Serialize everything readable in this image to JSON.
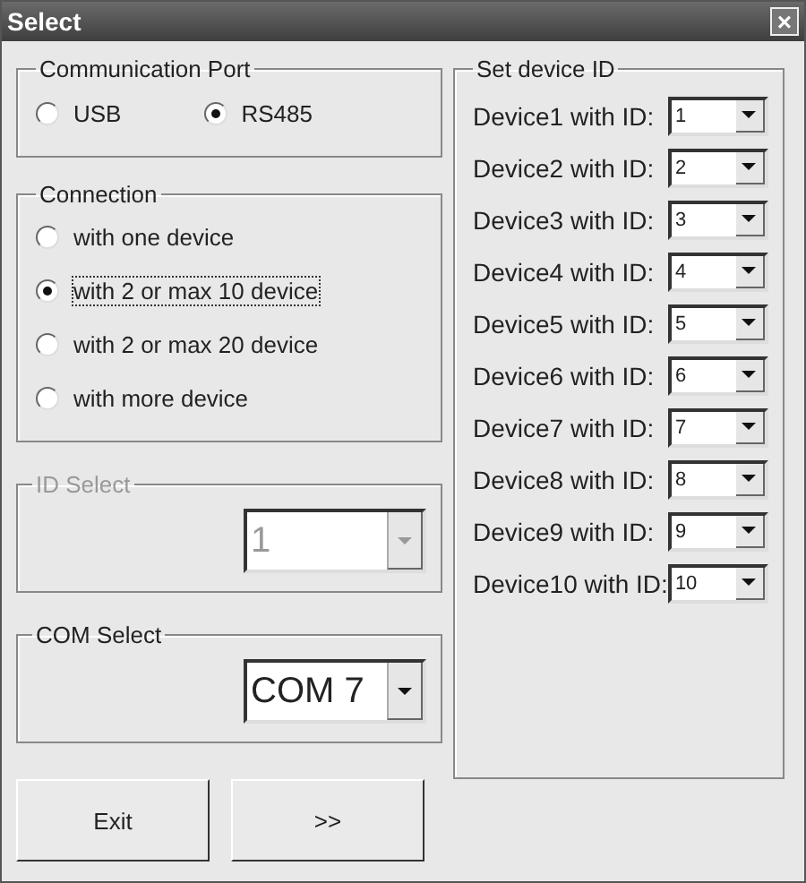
{
  "window": {
    "title": "Select",
    "close": "×"
  },
  "communication_port": {
    "title": "Communication Port",
    "options": [
      {
        "label": "USB",
        "selected": false
      },
      {
        "label": "RS485",
        "selected": true
      }
    ]
  },
  "connection": {
    "title": "Connection",
    "options": [
      {
        "label": "with one device",
        "selected": false,
        "focused": false
      },
      {
        "label": "with 2 or max 10 device",
        "selected": true,
        "focused": true
      },
      {
        "label": "with 2 or max 20 device",
        "selected": false,
        "focused": false
      },
      {
        "label": "with more device",
        "selected": false,
        "focused": false
      }
    ]
  },
  "id_select": {
    "title": "ID Select",
    "value": "1",
    "disabled": true
  },
  "com_select": {
    "title": "COM Select",
    "value": "COM 7",
    "disabled": false
  },
  "buttons": [
    "Exit",
    ">>"
  ],
  "device_ids": {
    "title": "Set device ID",
    "rows": [
      {
        "label": "Device1 with ID:",
        "value": "1"
      },
      {
        "label": "Device2 with ID:",
        "value": "2"
      },
      {
        "label": "Device3 with ID:",
        "value": "3"
      },
      {
        "label": "Device4 with ID:",
        "value": "4"
      },
      {
        "label": "Device5 with ID:",
        "value": "5"
      },
      {
        "label": "Device6 with ID:",
        "value": "6"
      },
      {
        "label": "Device7 with ID:",
        "value": "7"
      },
      {
        "label": "Device8 with ID:",
        "value": "8"
      },
      {
        "label": "Device9 with ID:",
        "value": "9"
      },
      {
        "label": "Device10 with ID:",
        "value": "10"
      }
    ]
  }
}
